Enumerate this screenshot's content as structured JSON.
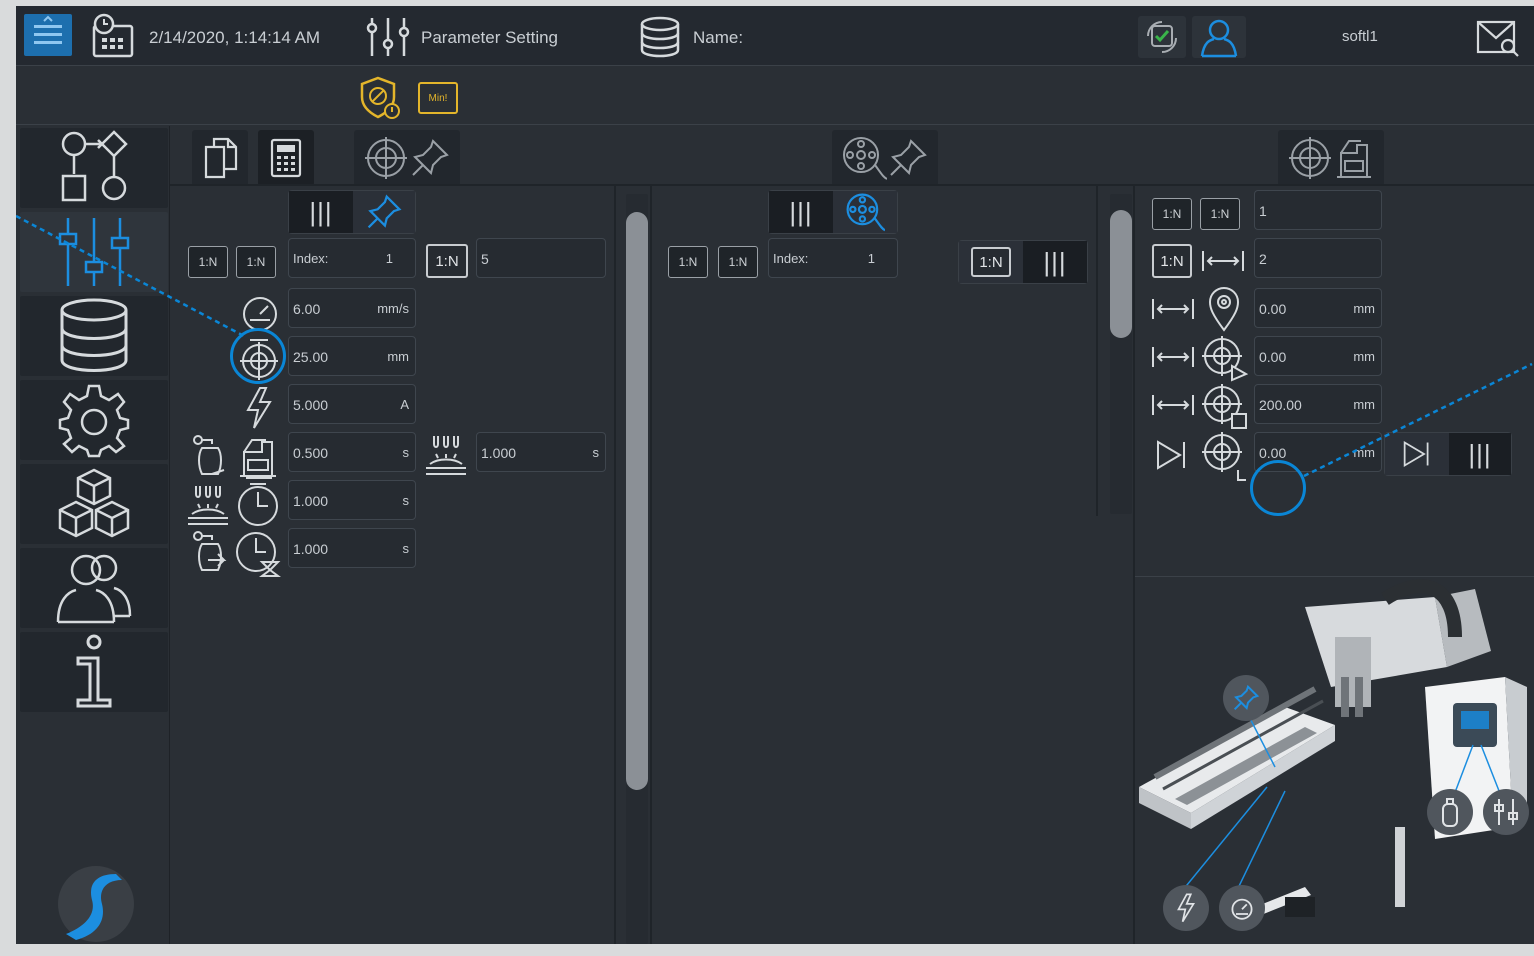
{
  "header": {
    "datetime": "2/14/2020, 1:14:14 AM",
    "page_title": "Parameter Setting",
    "name_label": "Name:",
    "user": "softl1",
    "min_badge": "Min!"
  },
  "sidebar": {
    "items": [
      "workflow-icon",
      "sliders-icon",
      "database-icon",
      "gear-icon",
      "cubes-icon",
      "users-icon",
      "info-icon"
    ]
  },
  "left_panel": {
    "index_label": "Index:",
    "index_value": "1",
    "count_badge": "1:N",
    "count_value": "5",
    "badge_minus": "1:N",
    "badge_plus": "1:N",
    "speed": {
      "value": "6.00",
      "unit": "mm/s"
    },
    "distance": {
      "value": "25.00",
      "unit": "mm"
    },
    "current": {
      "value": "5.000",
      "unit": "A"
    },
    "pre_gas": {
      "value": "0.500",
      "unit": "s"
    },
    "heat": {
      "value": "1.000",
      "unit": "s"
    },
    "weld_time": {
      "value": "1.000",
      "unit": "s"
    },
    "post_gas": {
      "value": "1.000",
      "unit": "s"
    }
  },
  "middle_panel": {
    "index_label": "Index:",
    "index_value": "1",
    "badge_minus": "1:N",
    "badge_plus": "1:N",
    "count_badge": "1:N"
  },
  "right_panel": {
    "badge_minus": "1:N",
    "badge_plus": "1:N",
    "count_badge": "1:N",
    "value1": "1",
    "value2": "2",
    "offset1": {
      "value": "0.00",
      "unit": "mm"
    },
    "offset2": {
      "value": "0.00",
      "unit": "mm"
    },
    "offset3": {
      "value": "200.00",
      "unit": "mm"
    },
    "offset4": {
      "value": "0.00",
      "unit": "mm"
    }
  },
  "colors": {
    "accent": "#0a86d6",
    "warning": "#e3b52b",
    "background": "#2a2f35"
  }
}
